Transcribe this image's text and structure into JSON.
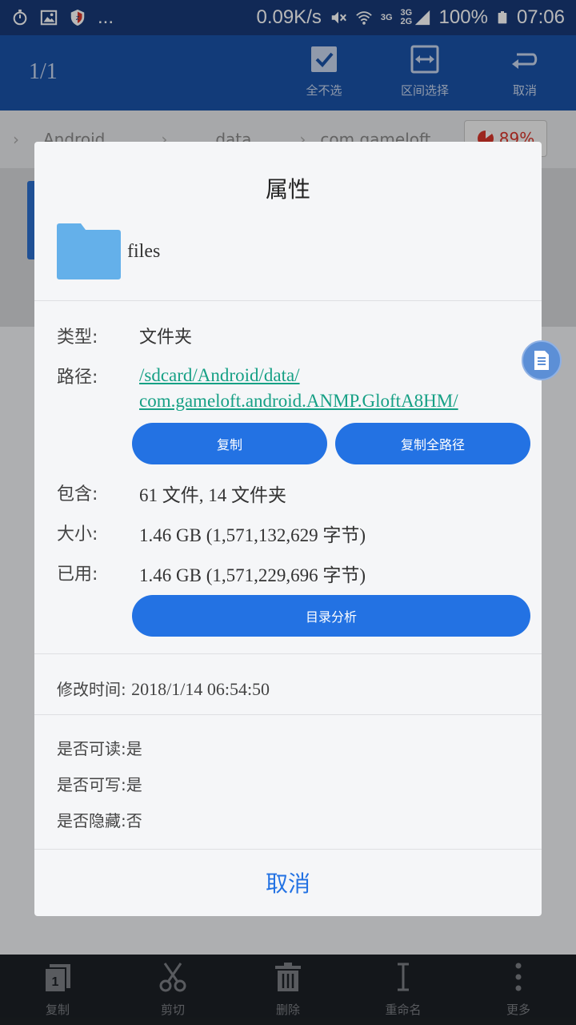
{
  "status_bar": {
    "icons_left": [
      "stopwatch-icon",
      "image-icon",
      "shield-icon"
    ],
    "more": "...",
    "speed": "0.09K/s",
    "network_3g": "3G",
    "network_3g2g": "3G 2G",
    "battery": "100%",
    "time": "07:06"
  },
  "app_bar": {
    "count": "1/1",
    "actions": [
      {
        "label": "全不选",
        "icon": "checkbox-icon"
      },
      {
        "label": "区间选择",
        "icon": "range-select-icon"
      },
      {
        "label": "取消",
        "icon": "undo-icon"
      }
    ]
  },
  "breadcrumb": {
    "items": [
      "Android",
      "data",
      "com.gameloft"
    ],
    "storage_percent": "89%"
  },
  "dialog": {
    "title": "属性",
    "folder_name": "files",
    "type_label": "类型:",
    "type_value": "文件夹",
    "path_label": "路径:",
    "path_line1": "/sdcard/Android/data/",
    "path_line2": "com.gameloft.android.ANMP.GloftA8HM/",
    "copy_button": "复制",
    "copy_full_path_button": "复制全路径",
    "contains_label": "包含:",
    "contains_value": "61 文件, 14 文件夹",
    "size_label": "大小:",
    "size_value": "1.46 GB (1,571,132,629 字节)",
    "used_label": "已用:",
    "used_value": "1.46 GB (1,571,229,696 字节)",
    "analyze_button": "目录分析",
    "modified_label": "修改时间:",
    "modified_value": "2018/1/14 06:54:50",
    "readable_label": "是否可读:",
    "readable_value": "是",
    "writable_label": "是否可写:",
    "writable_value": "是",
    "hidden_label": "是否隐藏:",
    "hidden_value": "否",
    "cancel_button": "取消"
  },
  "bottom_bar": {
    "items": [
      {
        "label": "复制",
        "icon": "copy-icon"
      },
      {
        "label": "剪切",
        "icon": "scissors-icon"
      },
      {
        "label": "删除",
        "icon": "trash-icon"
      },
      {
        "label": "重命名",
        "icon": "rename-icon"
      },
      {
        "label": "更多",
        "icon": "more-vertical-icon"
      }
    ]
  },
  "colors": {
    "app_bar": "#1a53a8",
    "status_bar": "#183a78",
    "accent": "#2372e3",
    "path_link": "#16a085",
    "folder": "#64b0ea",
    "storage_red": "#d9352a"
  }
}
